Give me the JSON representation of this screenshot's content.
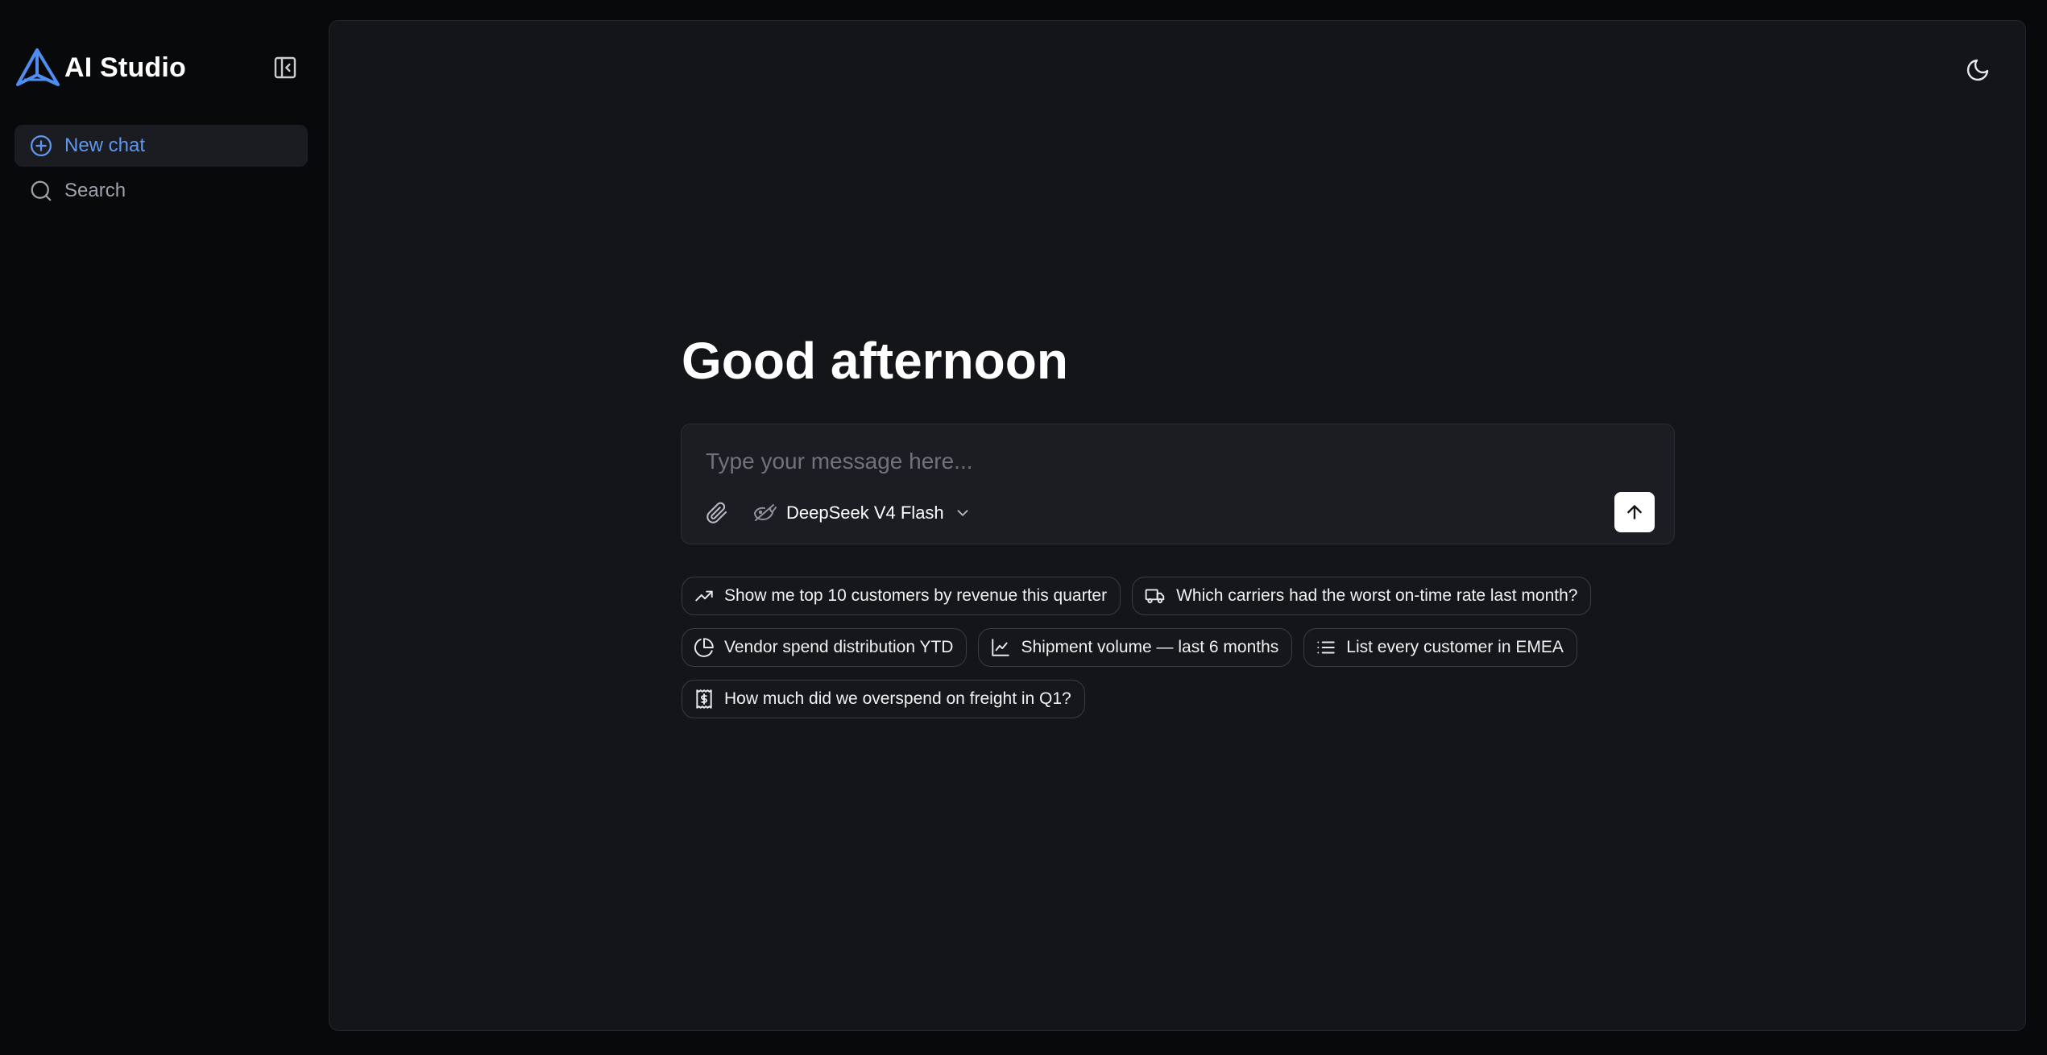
{
  "sidebar": {
    "brand": "AI Studio",
    "items": [
      {
        "label": "New chat",
        "icon": "plus-circle-icon"
      },
      {
        "label": "Search",
        "icon": "search-icon"
      }
    ]
  },
  "main": {
    "greeting": "Good afternoon",
    "composer": {
      "placeholder": "Type your message here...",
      "model": "DeepSeek V4 Flash"
    },
    "suggestions": [
      {
        "label": "Show me top 10 customers by revenue this quarter",
        "icon": "trending-up-icon"
      },
      {
        "label": "Which carriers had the worst on-time rate last month?",
        "icon": "truck-icon"
      },
      {
        "label": "Vendor spend distribution YTD",
        "icon": "pie-chart-icon"
      },
      {
        "label": "Shipment volume — last 6 months",
        "icon": "line-chart-icon"
      },
      {
        "label": "List every customer in EMEA",
        "icon": "list-icon"
      },
      {
        "label": "How much did we overspend on freight in Q1?",
        "icon": "receipt-dollar-icon"
      }
    ]
  },
  "colors": {
    "accent": "#5f97f0",
    "background": "#08090b",
    "panel": "#131519"
  }
}
